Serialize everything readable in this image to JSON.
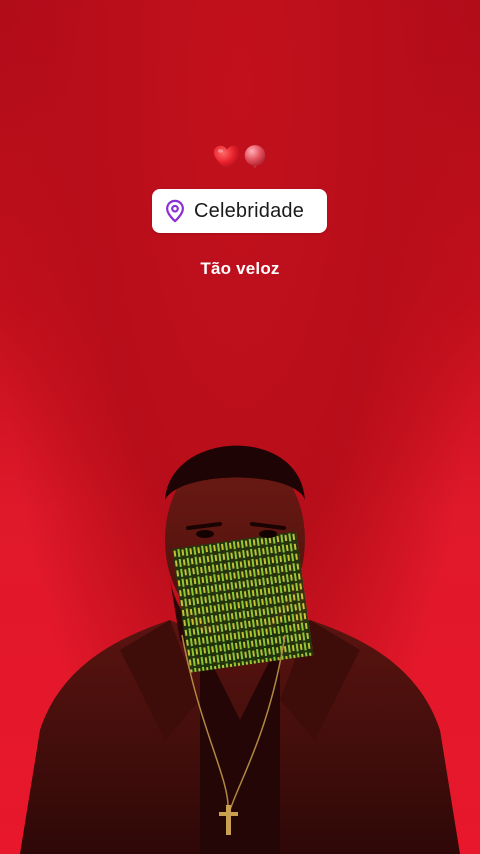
{
  "story": {
    "emojis": [
      "heart-emoji",
      "balloon-emoji"
    ],
    "location_sticker": {
      "icon": "location-pin-icon",
      "label": "Celebridade",
      "accent": "#8b2fd6"
    },
    "caption": "Tão veloz",
    "colors": {
      "background": "#d0131f",
      "sticker_background": "#ffffff",
      "caption_text": "#ffffff"
    }
  }
}
